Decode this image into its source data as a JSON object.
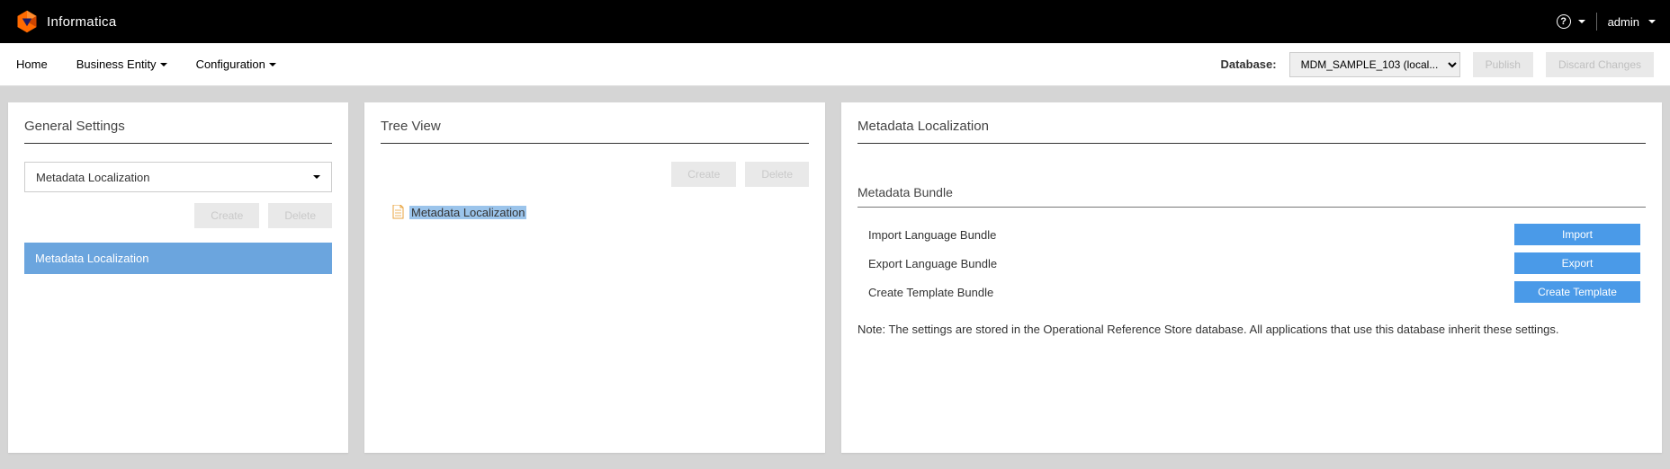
{
  "header": {
    "brand": "Informatica",
    "user": "admin"
  },
  "menu": {
    "home": "Home",
    "business_entity": "Business Entity",
    "configuration": "Configuration",
    "database_label": "Database:",
    "database_value": "MDM_SAMPLE_103 (local...",
    "publish": "Publish",
    "discard": "Discard Changes"
  },
  "panel_left": {
    "title": "General Settings",
    "dropdown_value": "Metadata Localization",
    "create": "Create",
    "delete": "Delete",
    "active_item": "Metadata Localization"
  },
  "panel_middle": {
    "title": "Tree View",
    "create": "Create",
    "delete": "Delete",
    "node_label": "Metadata Localization"
  },
  "panel_right": {
    "title": "Metadata Localization",
    "section": "Metadata Bundle",
    "rows": [
      {
        "label": "Import Language Bundle",
        "button": "Import"
      },
      {
        "label": "Export Language Bundle",
        "button": "Export"
      },
      {
        "label": "Create Template Bundle",
        "button": "Create Template"
      }
    ],
    "note": "Note: The settings are stored in the Operational Reference Store database. All applications that use this database inherit these settings."
  }
}
